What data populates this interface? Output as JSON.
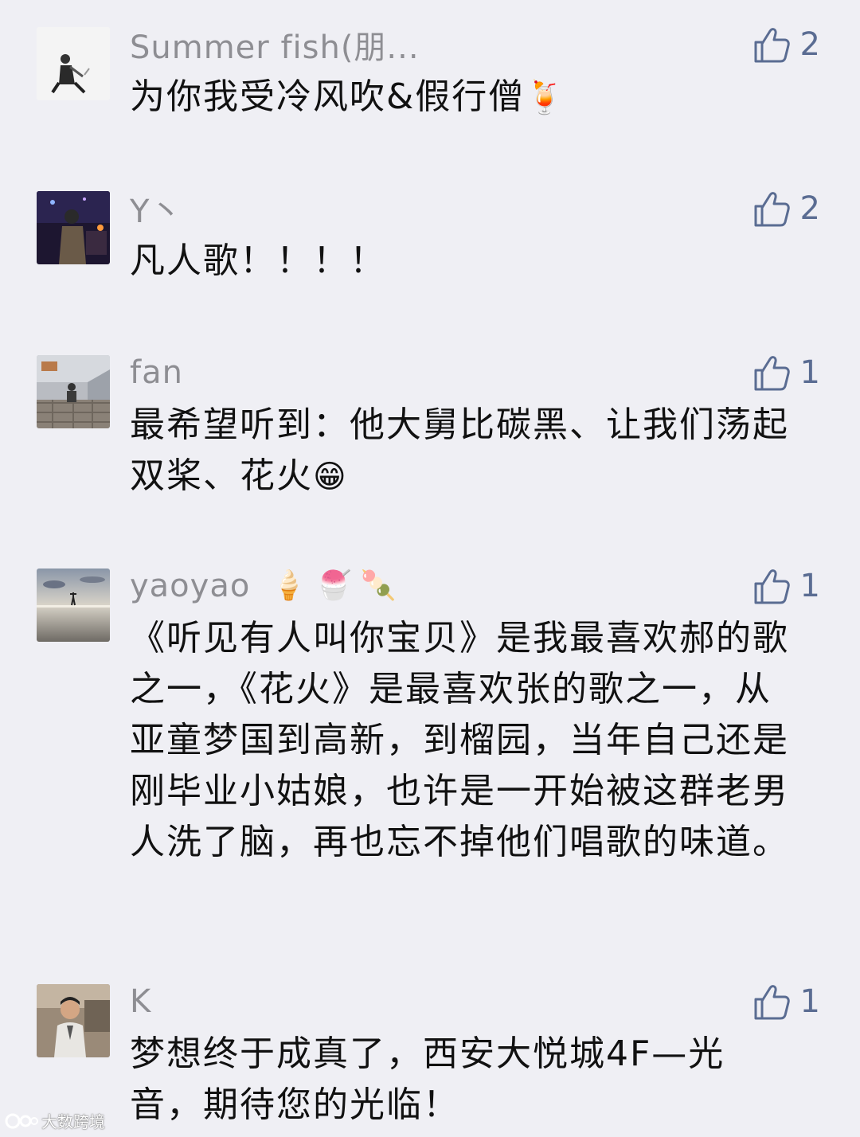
{
  "comments": [
    {
      "name": "Summer fish(朋...",
      "name_emoji": "",
      "likes": "2",
      "text": "为你我受冷风吹&假行僧",
      "text_emoji": "🍹"
    },
    {
      "name": "Y丶",
      "name_emoji": "",
      "likes": "2",
      "text": "凡人歌！！！！",
      "text_emoji": ""
    },
    {
      "name": "fan",
      "name_emoji": "",
      "likes": "1",
      "text": "最希望听到：他大舅比碳黑、让我们荡起双桨、花火",
      "text_emoji": "😁"
    },
    {
      "name": "yaoyao",
      "name_emoji": "🍦 🍧 🍡",
      "likes": "1",
      "text": "《听见有人叫你宝贝》是我最喜欢郝的歌之一，《花火》是最喜欢张的歌之一，从亚童梦国到高新，到榴园，当年自己还是刚毕业小姑娘，也许是一开始被这群老男人洗了脑，再也忘不掉他们唱歌的味道。",
      "text_emoji": ""
    },
    {
      "name": "K",
      "name_emoji": "",
      "likes": "1",
      "text": "梦想终于成真了，西安大悦城4F—光音，期待您的光临！",
      "text_emoji": ""
    }
  ],
  "watermark": "大数跨境",
  "colors": {
    "background": "#efeff4",
    "name": "#8e8e93",
    "like": "#5a6c92",
    "text": "#111111"
  }
}
